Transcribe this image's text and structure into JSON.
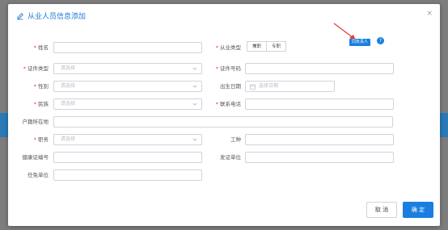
{
  "dialog": {
    "title": "从业人员信息添加",
    "close_glyph": "×"
  },
  "required_mark": "*",
  "fields": {
    "name_label": "姓名",
    "practitioner_type_label": "从业类型",
    "practitioner_type_options": [
      "兼职",
      "专职"
    ],
    "id_type_label": "证件类型",
    "id_type_placeholder": "请选择",
    "id_number_label": "证件号码",
    "gender_label": "性别",
    "gender_placeholder": "请选择",
    "birth_date_label": "出生日期",
    "birth_date_placeholder": "选择日期",
    "ethnicity_label": "民族",
    "ethnicity_placeholder": "请选择",
    "phone_label": "联系电话",
    "household_label": "户籍所在地",
    "position_label": "职务",
    "position_placeholder": "请选择",
    "job_type_label": "工种",
    "health_cert_label": "健康证编号",
    "issuer_label": "发证单位",
    "appointing_unit_label": "任免单位"
  },
  "responsible_tag": "同负责人",
  "help_glyph": "?",
  "footer": {
    "cancel_label": "取 消",
    "confirm_label": "确 定"
  },
  "colors": {
    "accent": "#1a7ee0",
    "required": "#e0443a",
    "annotation_arrow": "#e53935"
  },
  "icons": [
    "pencil-icon",
    "close-icon",
    "chevron-down-icon",
    "calendar-icon",
    "question-icon",
    "annotation-arrow"
  ]
}
